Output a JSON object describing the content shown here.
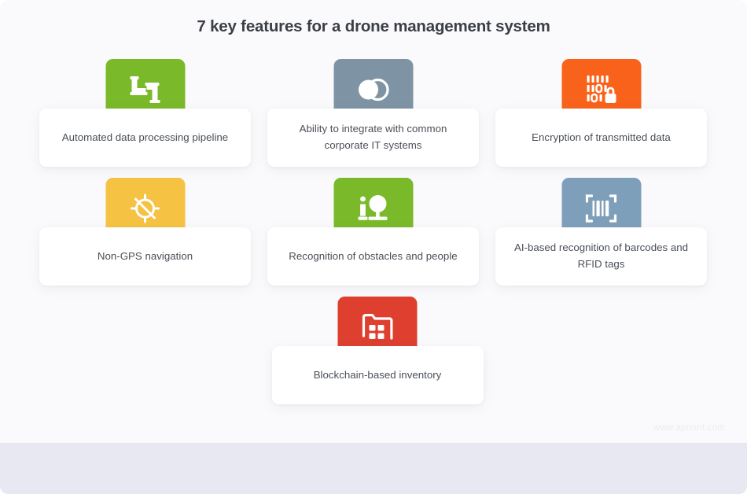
{
  "header": {
    "title": "7 key features for a drone management system"
  },
  "watermark": "www.apriorit.com",
  "colors": {
    "page_background": "#fafafc",
    "bottom_strip": "#e8e8f2",
    "card_background": "#ffffff",
    "title_text": "#3b3f45",
    "label_text": "#4a4f57",
    "green": "#7ab929",
    "slate": "#7e94a4",
    "orange": "#f9621a",
    "amber": "#f5c243",
    "steel_blue": "#7e9fba",
    "red": "#de3f2e"
  },
  "features": [
    {
      "label": "Automated data processing pipeline",
      "icon": "pipeline-icon",
      "color": "#7ab929"
    },
    {
      "label": "Ability to integrate with common corporate IT systems",
      "icon": "venn-overlap-icon",
      "color": "#7e94a4"
    },
    {
      "label": "Encryption of transmitted data",
      "icon": "binary-lock-icon",
      "color": "#f9621a"
    },
    {
      "label": "Non-GPS navigation",
      "icon": "gps-off-icon",
      "color": "#f5c243"
    },
    {
      "label": "Recognition of obstacles and people",
      "icon": "person-tree-icon",
      "color": "#7ab929"
    },
    {
      "label": "AI-based recognition of barcodes and RFID tags",
      "icon": "barcode-scan-icon",
      "color": "#7e9fba"
    },
    {
      "label": "Blockchain-based inventory",
      "icon": "folder-blocks-icon",
      "color": "#de3f2e"
    }
  ]
}
